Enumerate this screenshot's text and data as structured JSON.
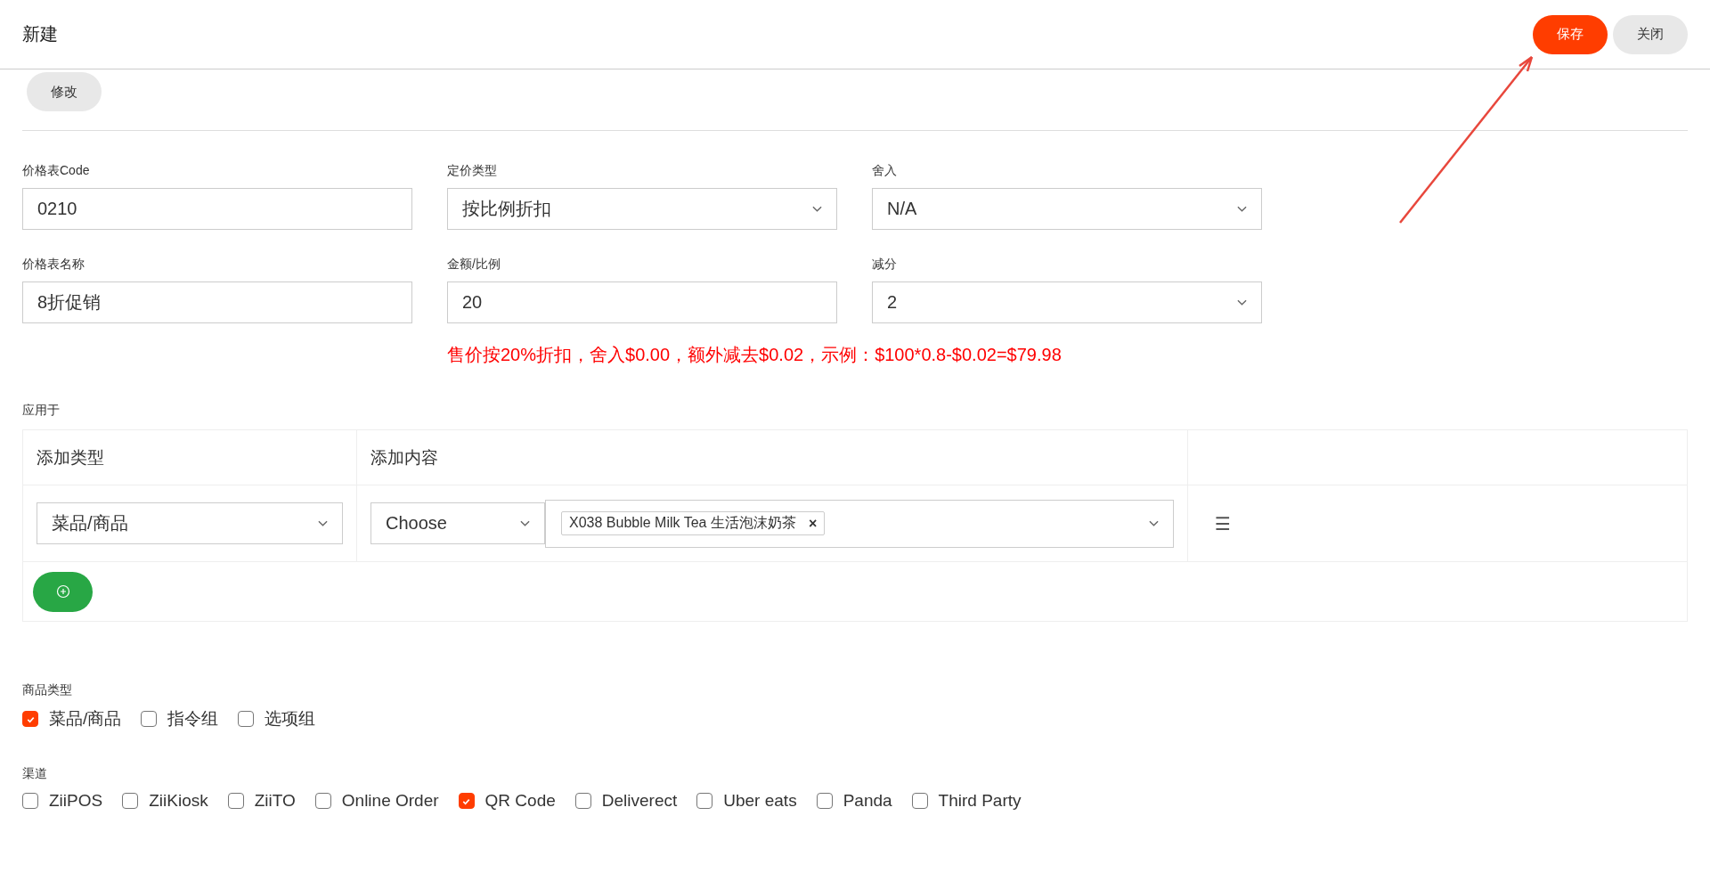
{
  "header": {
    "title": "新建",
    "buttons": [
      {
        "label": "保存",
        "kind": "primary"
      },
      {
        "label": "关闭",
        "kind": "secondary"
      }
    ]
  },
  "edit_button": "修改",
  "form": {
    "fields": [
      {
        "label": "价格表Code",
        "value": "0210",
        "kind": "input"
      },
      {
        "label": "定价类型",
        "value": "按比例折扣",
        "kind": "select"
      },
      {
        "label": "舍入",
        "value": "N/A",
        "kind": "select"
      },
      {
        "label": "价格表名称",
        "value": "8折促销",
        "kind": "input"
      },
      {
        "label": "金额/比例",
        "value": "20",
        "kind": "input"
      },
      {
        "label": "减分",
        "value": "2",
        "kind": "select"
      }
    ],
    "hint": "售价按20%折扣，舍入$0.00，额外减去$0.02，示例：$100*0.8-$0.02=$79.98"
  },
  "apply_to": {
    "label": "应用于",
    "columns": [
      "添加类型",
      "添加内容"
    ],
    "rows": [
      {
        "type": "菜品/商品",
        "choose": "Choose",
        "tags": [
          "X038 Bubble Milk Tea 生活泡沫奶茶"
        ],
        "tag_remove": "×",
        "menu": "☰"
      }
    ]
  },
  "product_type": {
    "label": "商品类型",
    "options": [
      {
        "label": "菜品/商品",
        "checked": true
      },
      {
        "label": "指令组",
        "checked": false
      },
      {
        "label": "选项组",
        "checked": false
      }
    ]
  },
  "channels": {
    "label": "渠道",
    "options": [
      {
        "label": "ZiiPOS",
        "checked": false
      },
      {
        "label": "ZiiKiosk",
        "checked": false
      },
      {
        "label": "ZiiTO",
        "checked": false
      },
      {
        "label": "Online Order",
        "checked": false
      },
      {
        "label": "QR Code",
        "checked": true
      },
      {
        "label": "Deliverect",
        "checked": false
      },
      {
        "label": "Uber eats",
        "checked": false
      },
      {
        "label": "Panda",
        "checked": false
      },
      {
        "label": "Third Party",
        "checked": false
      }
    ]
  }
}
